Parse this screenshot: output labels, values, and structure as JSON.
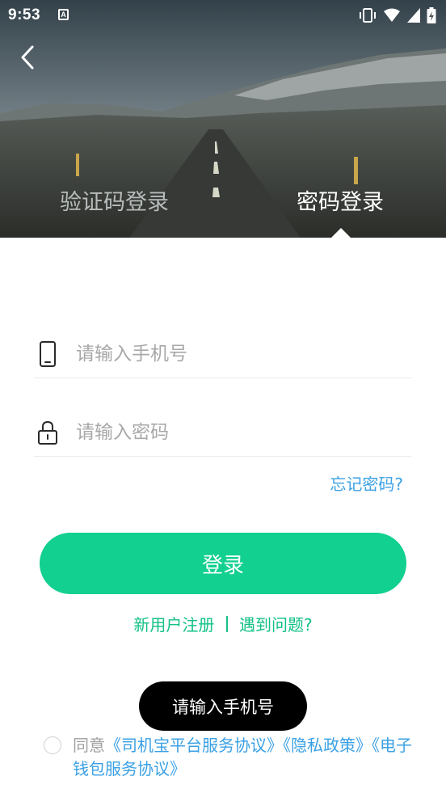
{
  "status_bar": {
    "time": "9:53",
    "icons": [
      "notification-a-icon",
      "vibrate-icon",
      "wifi-icon",
      "signal-icon",
      "battery-icon"
    ]
  },
  "header": {
    "back_icon": "chevron-left-icon",
    "tabs": [
      {
        "label": "验证码登录",
        "active": false
      },
      {
        "label": "密码登录",
        "active": true
      }
    ]
  },
  "form": {
    "phone": {
      "icon": "phone-icon",
      "value": "",
      "placeholder": "请输入手机号"
    },
    "password": {
      "icon": "lock-icon",
      "value": "",
      "placeholder": "请输入密码"
    },
    "forgot_label": "忘记密码?",
    "login_label": "登录"
  },
  "links": {
    "register": "新用户注册",
    "problem": "遇到问题?"
  },
  "toast": "请输入手机号",
  "agreement": {
    "prefix": "同意",
    "items": [
      "《司机宝平台服务协议》",
      "《隐私政策》",
      "《电子钱包服务协议》"
    ],
    "checked": false
  },
  "colors": {
    "accent": "#12d08f",
    "link": "#3aa0e4",
    "link_green": "#12c185",
    "toast_bg": "#000000"
  }
}
